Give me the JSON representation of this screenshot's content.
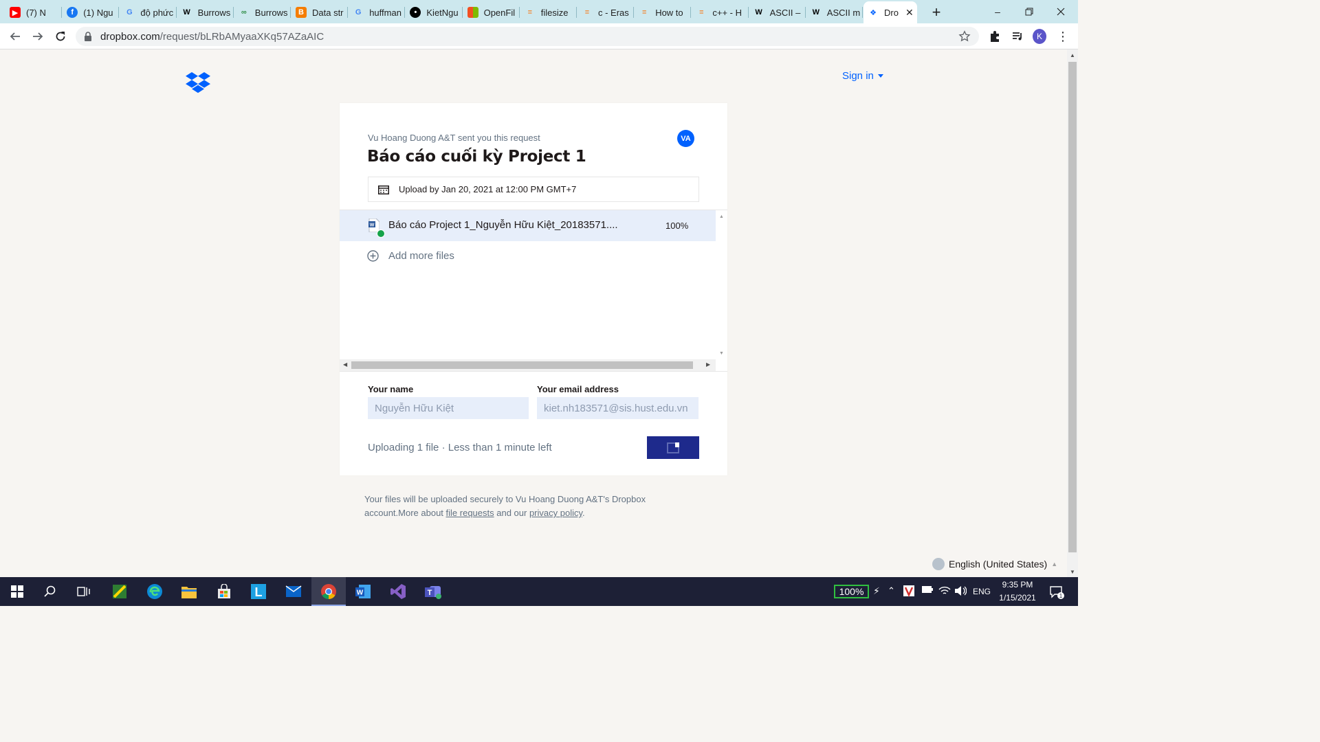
{
  "browser": {
    "tabs": [
      {
        "title": "(7) N",
        "icon": "youtube-icon",
        "color": "#ff0000"
      },
      {
        "title": "(1) Ngu",
        "icon": "facebook-icon",
        "color": "#1877f2"
      },
      {
        "title": "độ phức",
        "icon": "google-icon",
        "color": "#4285f4"
      },
      {
        "title": "Burrows",
        "icon": "wikipedia-icon",
        "color": "#000000"
      },
      {
        "title": "Burrows",
        "icon": "geeksforgeeks-icon",
        "color": "#2f8d46"
      },
      {
        "title": "Data str",
        "icon": "blogger-icon",
        "color": "#f57d00"
      },
      {
        "title": "huffman",
        "icon": "google-icon",
        "color": "#4285f4"
      },
      {
        "title": "KietNgu",
        "icon": "github-icon",
        "color": "#000000"
      },
      {
        "title": "OpenFil",
        "icon": "microsoft-icon",
        "color": "#f25022"
      },
      {
        "title": "filesize",
        "icon": "stackoverflow-icon",
        "color": "#f48024"
      },
      {
        "title": "c - Eras",
        "icon": "stackoverflow-icon",
        "color": "#f48024"
      },
      {
        "title": "How to",
        "icon": "stackoverflow-icon",
        "color": "#f48024"
      },
      {
        "title": "c++ - H",
        "icon": "stackoverflow-icon",
        "color": "#f48024"
      },
      {
        "title": "ASCII –",
        "icon": "wikipedia-icon",
        "color": "#000000"
      },
      {
        "title": "ASCII m",
        "icon": "wikipedia-icon",
        "color": "#000000"
      },
      {
        "title": "Dro",
        "icon": "dropbox-icon",
        "color": "#0061fe",
        "active": true
      }
    ],
    "url_host": "dropbox.com",
    "url_path": "/request/bLRbAMyaaXKq57AZaAIC",
    "profile_initial": "K"
  },
  "page": {
    "sign_in": "Sign in",
    "sender_line": "Vu Hoang Duong A&T sent you this request",
    "sender_badge": "VA",
    "request_title": "Báo cáo cuối kỳ Project 1",
    "deadline": "Upload by Jan 20, 2021 at 12:00 PM GMT+7",
    "file": {
      "name": "Báo cáo Project 1_Nguyễn Hữu Kiệt_20183571....",
      "progress": "100%"
    },
    "add_more": "Add more files",
    "name_label": "Your name",
    "name_value": "Nguyễn Hữu Kiệt",
    "email_label": "Your email address",
    "email_value": "kiet.nh183571@sis.hust.edu.vn",
    "status": "Uploading 1 file · Less than 1 minute left",
    "footer_pre": "Your files will be uploaded securely to Vu Hoang Duong A&T's Dropbox account.More about ",
    "footer_link1": "file requests",
    "footer_mid": " and our ",
    "footer_link2": "privacy policy",
    "footer_end": ".",
    "language": "English (United States)",
    "brand_color": "#0061fe"
  },
  "taskbar": {
    "battery": "100%",
    "lang": "ENG",
    "time": "9:35 PM",
    "date": "1/15/2021",
    "notifications": "1"
  }
}
